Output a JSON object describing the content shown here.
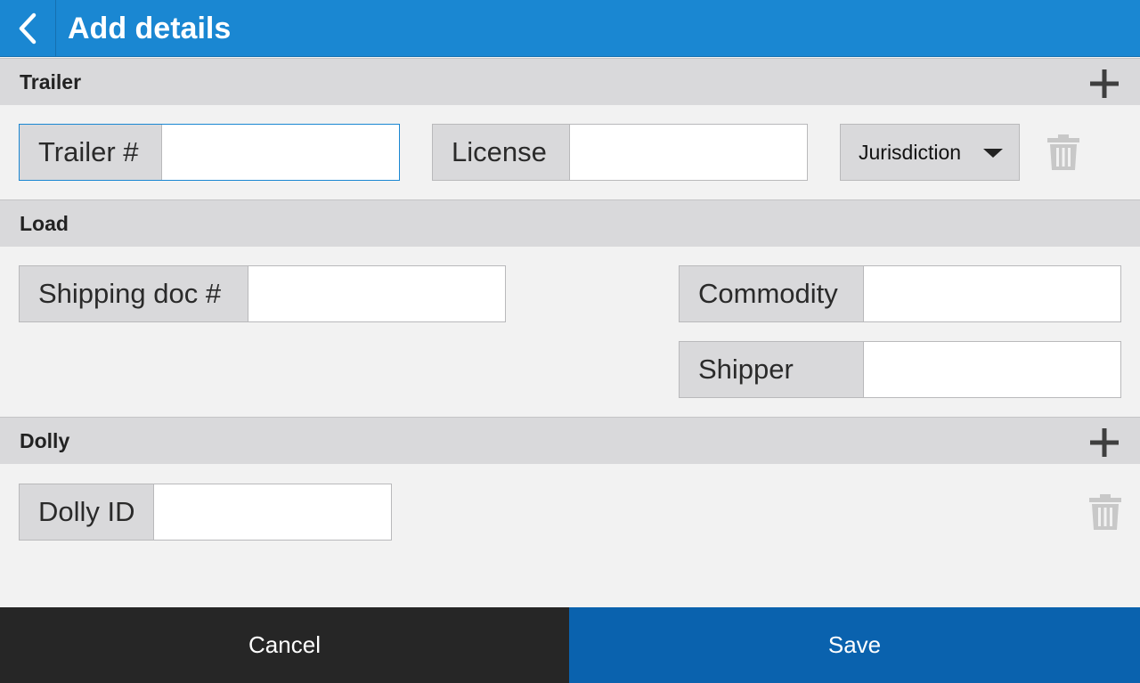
{
  "appbar": {
    "title": "Add details",
    "back_icon": "chevron-left-icon"
  },
  "trailer": {
    "header": "Trailer",
    "fields": {
      "trailer_number": {
        "label": "Trailer #",
        "value": ""
      },
      "license": {
        "label": "License",
        "value": ""
      }
    },
    "jurisdiction": {
      "label": "Jurisdiction"
    }
  },
  "load": {
    "header": "Load",
    "fields": {
      "shipping_doc": {
        "label": "Shipping doc #",
        "value": ""
      },
      "commodity": {
        "label": "Commodity",
        "value": ""
      },
      "shipper": {
        "label": "Shipper",
        "value": ""
      }
    }
  },
  "dolly": {
    "header": "Dolly",
    "fields": {
      "dolly_id": {
        "label": "Dolly ID",
        "value": ""
      }
    }
  },
  "footer": {
    "cancel_label": "Cancel",
    "save_label": "Save"
  },
  "colors": {
    "appbar": "#1a87d2",
    "save": "#0a62ae",
    "cancel": "#262626",
    "section": "#d9d9db",
    "background": "#f2f2f2"
  }
}
